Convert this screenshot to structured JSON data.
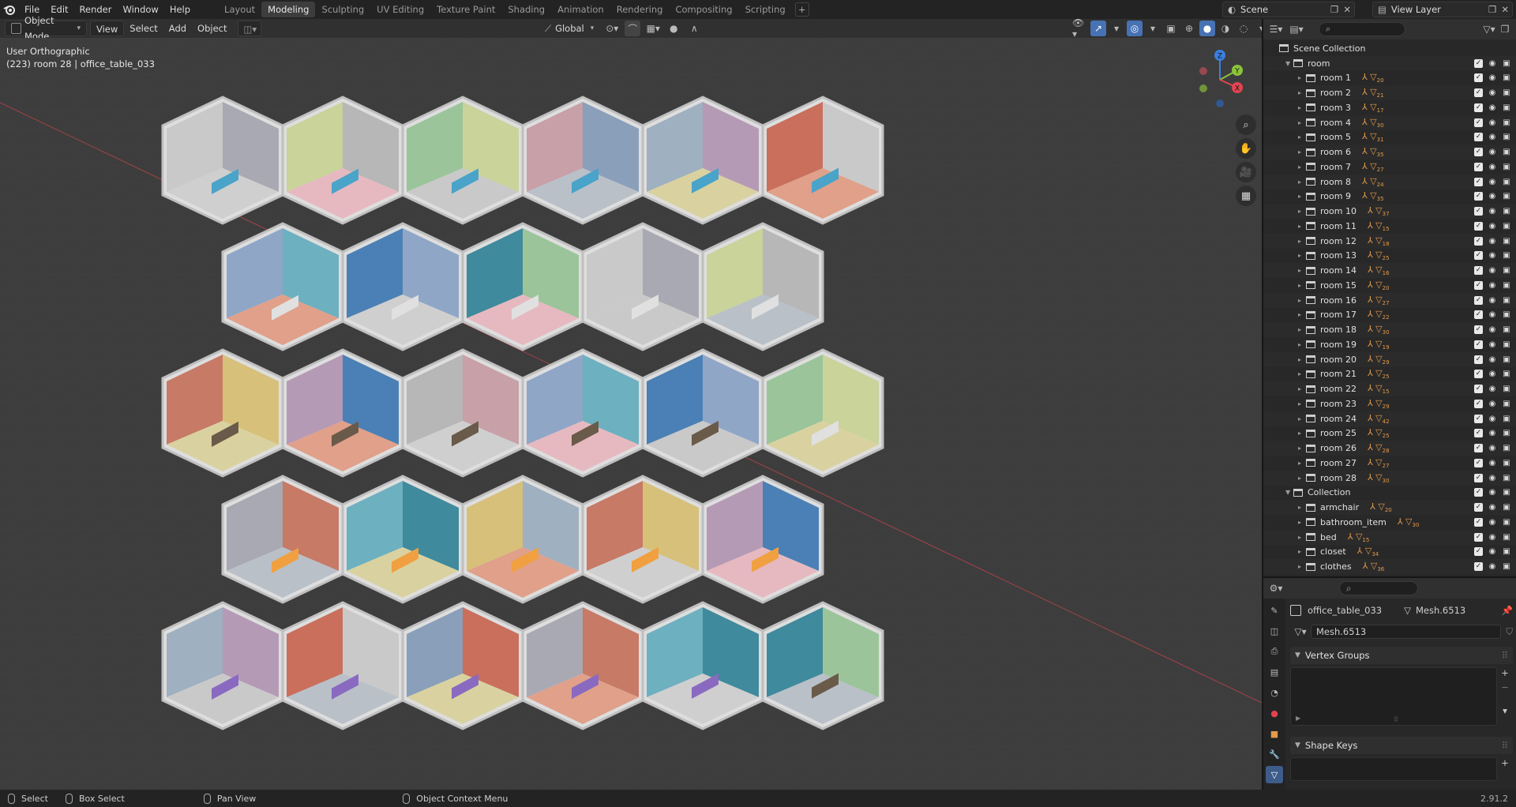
{
  "topbar": {
    "menus": [
      "File",
      "Edit",
      "Render",
      "Window",
      "Help"
    ],
    "workspaces": [
      "Layout",
      "Modeling",
      "Sculpting",
      "UV Editing",
      "Texture Paint",
      "Shading",
      "Animation",
      "Rendering",
      "Compositing",
      "Scripting"
    ],
    "active_workspace": "Modeling",
    "scene": "Scene",
    "view_layer": "View Layer"
  },
  "viewport_header": {
    "mode": "Object Mode",
    "menus": [
      "View",
      "Select",
      "Add",
      "Object"
    ],
    "transform_orientation": "Global"
  },
  "viewport": {
    "view_name": "User Orthographic",
    "context_info": "(223) room 28 | office_table_033"
  },
  "gizmo_axes": {
    "x": "X",
    "y": "Y",
    "z": "Z"
  },
  "outliner": {
    "root": "Scene Collection",
    "top_collection": "room",
    "rooms": [
      {
        "name": "room 1",
        "meshes": "20"
      },
      {
        "name": "room 2",
        "meshes": "21"
      },
      {
        "name": "room 3",
        "meshes": "17"
      },
      {
        "name": "room 4",
        "meshes": "30"
      },
      {
        "name": "room 5",
        "meshes": "31"
      },
      {
        "name": "room 6",
        "meshes": "35"
      },
      {
        "name": "room 7",
        "meshes": "27"
      },
      {
        "name": "room 8",
        "meshes": "24"
      },
      {
        "name": "room 9",
        "meshes": "35"
      },
      {
        "name": "room 10",
        "meshes": "37"
      },
      {
        "name": "room 11",
        "meshes": "15"
      },
      {
        "name": "room 12",
        "meshes": "18"
      },
      {
        "name": "room 13",
        "meshes": "25"
      },
      {
        "name": "room 14",
        "meshes": "16"
      },
      {
        "name": "room 15",
        "meshes": "20"
      },
      {
        "name": "room 16",
        "meshes": "27"
      },
      {
        "name": "room 17",
        "meshes": "22"
      },
      {
        "name": "room 18",
        "meshes": "30"
      },
      {
        "name": "room 19",
        "meshes": "19"
      },
      {
        "name": "room 20",
        "meshes": "29"
      },
      {
        "name": "room 21",
        "meshes": "25"
      },
      {
        "name": "room 22",
        "meshes": "15"
      },
      {
        "name": "room 23",
        "meshes": "29"
      },
      {
        "name": "room 24",
        "meshes": "42"
      },
      {
        "name": "room 25",
        "meshes": "25"
      },
      {
        "name": "room 26",
        "meshes": "28"
      },
      {
        "name": "room 27",
        "meshes": "27"
      },
      {
        "name": "room 28",
        "meshes": "30"
      }
    ],
    "second_collection": "Collection",
    "collection_items": [
      {
        "name": "armchair",
        "meshes": "20"
      },
      {
        "name": "bathroom_item",
        "meshes": "30"
      },
      {
        "name": "bed",
        "meshes": "15"
      },
      {
        "name": "closet",
        "meshes": "34"
      },
      {
        "name": "clothes",
        "meshes": "36"
      }
    ]
  },
  "properties": {
    "object_name": "office_table_033",
    "mesh_name": "Mesh.6513",
    "data_field": "Mesh.6513",
    "panels": [
      "Vertex Groups",
      "Shape Keys"
    ]
  },
  "statusbar": {
    "items": [
      "Select",
      "Box Select",
      "Pan View",
      "Object Context Menu"
    ],
    "version": "2.91.2"
  },
  "colors": {
    "active_blue": "#4772b3",
    "mesh_orange": "#e39a4a",
    "axis_x": "#e2444f",
    "axis_y": "#8bc33a",
    "axis_z": "#3b7fe0"
  },
  "icons": [
    "blender-logo-icon",
    "search-icon",
    "filter-icon",
    "zoom-icon",
    "hand-icon",
    "camera-icon",
    "grid-icon",
    "eye-icon",
    "camera-render-icon",
    "wrench-icon",
    "mouse-icon"
  ]
}
